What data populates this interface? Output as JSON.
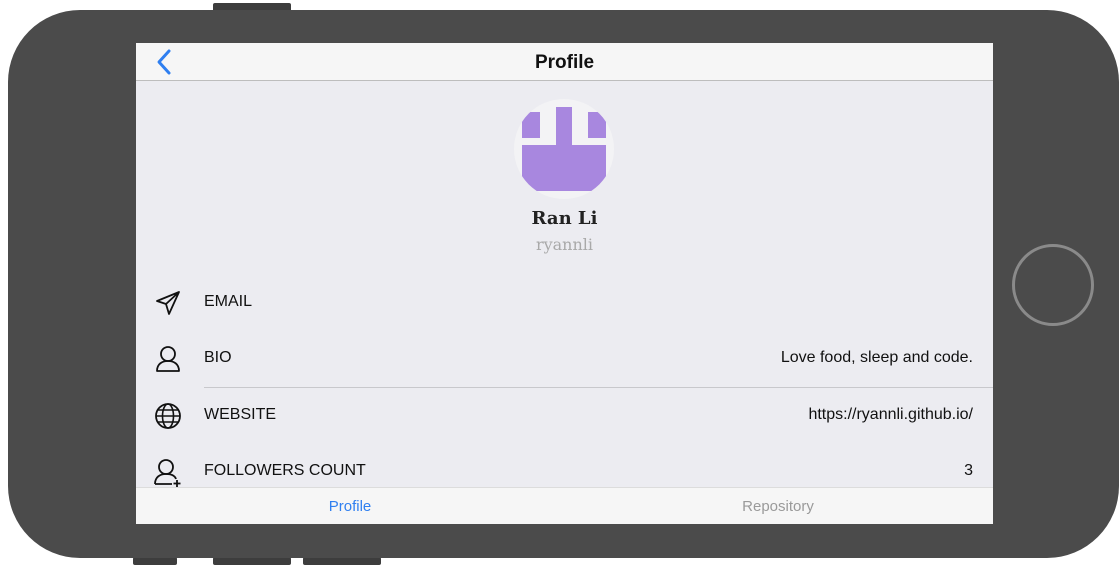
{
  "navbar": {
    "title": "Profile",
    "back_icon": "chevron-left-icon"
  },
  "profile": {
    "name": "Ran Li",
    "login": "ryannli"
  },
  "info_rows": [
    {
      "icon": "send-icon",
      "label": "EMAIL",
      "value": ""
    },
    {
      "icon": "user-icon",
      "label": "BIO",
      "value": "Love food, sleep and code."
    },
    {
      "icon": "globe-icon",
      "label": "WEBSITE",
      "value": "https://ryannli.github.io/"
    },
    {
      "icon": "user-plus-icon",
      "label": "FOLLOWERS COUNT",
      "value": "3"
    }
  ],
  "tabs": [
    {
      "label": "Profile",
      "active": true
    },
    {
      "label": "Repository",
      "active": false
    }
  ],
  "colors": {
    "accent": "#2f7ff0",
    "avatar": "#a887df",
    "device": "#4b4b4b"
  }
}
